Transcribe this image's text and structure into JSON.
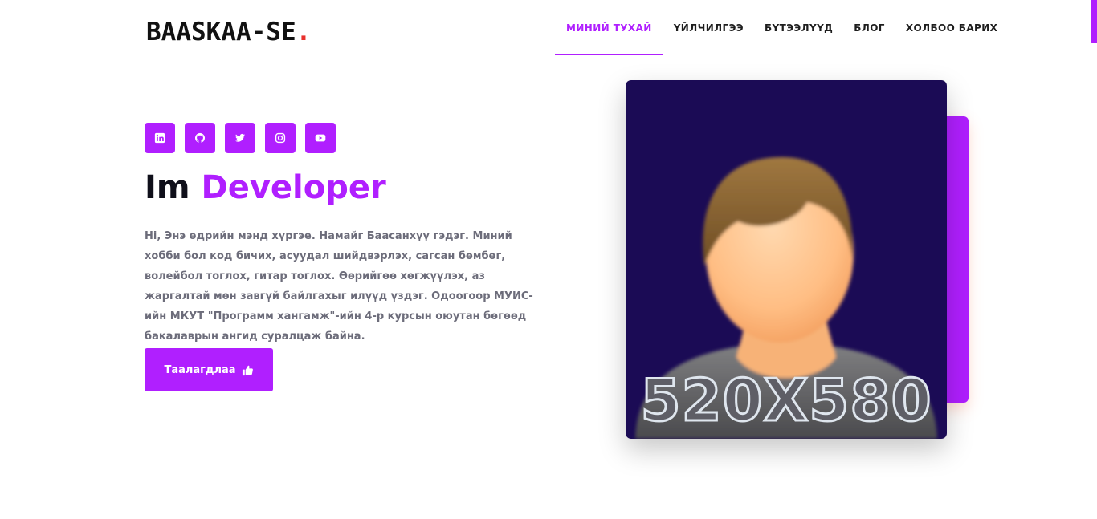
{
  "brand": {
    "name": "BAASKAA-SE",
    "dot": "."
  },
  "nav": {
    "items": [
      {
        "label": "МИНИЙ ТУХАЙ",
        "active": true
      },
      {
        "label": "ҮЙЛЧИЛГЭЭ",
        "active": false
      },
      {
        "label": "БҮТЭЭЛҮҮД",
        "active": false
      },
      {
        "label": "БЛОГ",
        "active": false
      },
      {
        "label": "ХОЛБОО БАРИХ",
        "active": false
      }
    ]
  },
  "socials": [
    {
      "icon": "linkedin-icon"
    },
    {
      "icon": "github-icon"
    },
    {
      "icon": "twitter-icon"
    },
    {
      "icon": "instagram-icon"
    },
    {
      "icon": "youtube-icon"
    }
  ],
  "hero": {
    "heading_prefix": "Im",
    "heading_accent": "Developer",
    "bio": "Hi, Энэ өдрийн мэнд хүргэе. Намайг Баасанхүү гэдэг. Миний хобби бол код бичих, асуудал шийдвэрлэх, сагсан бөмбөг, волейбол тоглох, гитар тоглох. Өөрийгөө хөгжүүлэх, аз жаргалтай мөн завгүй байлгахыг илүүд үздэг. Одоогоор МУИС-ийн МКУТ \"Программ хангамж\"-ийн 4-р курсын оюутан бөгөөд бакалаврын ангид суралцаж байна.",
    "button_label": "Таалагдлаа",
    "button_icon": "thumbs-up-icon"
  },
  "photo": {
    "placeholder_label": "520X580"
  },
  "colors": {
    "accent": "#b01fff",
    "brand_dot": "#e8302c",
    "photo_bg": "#1b0b55"
  }
}
